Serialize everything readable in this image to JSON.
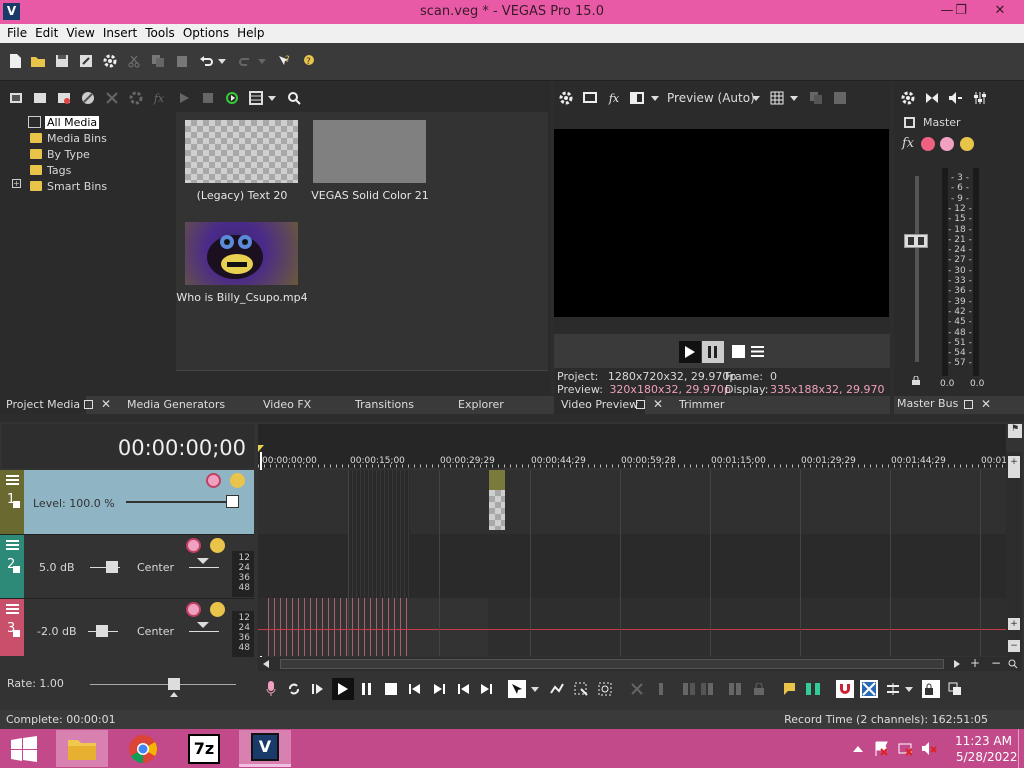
{
  "window": {
    "title": "scan.veg * - VEGAS Pro 15.0",
    "logo_letter": "V"
  },
  "menu": [
    "File",
    "Edit",
    "View",
    "Insert",
    "Tools",
    "Options",
    "Help"
  ],
  "project_media": {
    "tree": [
      "All Media",
      "Media Bins",
      "By Type",
      "Tags",
      "Smart Bins"
    ],
    "media": [
      {
        "caption": "(Legacy) Text 20"
      },
      {
        "caption": "VEGAS Solid Color 21"
      },
      {
        "caption": "Who is Billy_Csupo.mp4"
      }
    ]
  },
  "docked_tabs_left": [
    "Project Media",
    "Media Generators",
    "Video FX",
    "Transitions",
    "Explorer"
  ],
  "preview": {
    "mode_label": "Preview (Auto)",
    "project_label": "Project:",
    "project_value": "1280x720x32, 29.970p",
    "frame_label": "Frame:",
    "frame_value": "0",
    "preview_label": "Preview:",
    "preview_value": "320x180x32, 29.970p",
    "display_label": "Display:",
    "display_value": "335x188x32, 29.970",
    "tabs": [
      "Video Preview",
      "Trimmer"
    ]
  },
  "master": {
    "label": "Master",
    "scale": [
      "3",
      "6",
      "9",
      "12",
      "15",
      "18",
      "21",
      "24",
      "27",
      "30",
      "33",
      "36",
      "39",
      "42",
      "45",
      "48",
      "51",
      "54",
      "57"
    ],
    "left_value": "0.0",
    "right_value": "0.0",
    "tab": "Master Bus"
  },
  "timeline": {
    "timecode": "00:00:00;00",
    "ruler": [
      "00:00:00;00",
      "00:00:15;00",
      "00:00:29;29",
      "00:00:44;29",
      "00:00:59;28",
      "00:01:15;00",
      "00:01:29;29",
      "00:01:44;29",
      "00:01:5"
    ],
    "tracks": [
      {
        "number": "1",
        "level": "Level: 100.0 %"
      },
      {
        "number": "2",
        "volume": "5.0 dB",
        "pan": "Center",
        "gutter": [
          "12",
          "24",
          "36",
          "48"
        ]
      },
      {
        "number": "3",
        "volume": "-2.0 dB",
        "pan": "Center",
        "gutter": [
          "12",
          "24",
          "36",
          "48"
        ]
      }
    ],
    "rate": "Rate: 1.00"
  },
  "status": {
    "left": "Complete: 00:00:01",
    "right": "Record Time (2 channels): 162:51:05"
  },
  "taskbar": {
    "time": "11:23 AM",
    "date": "5/28/2022",
    "sevenzip": "7z",
    "vegas": "V"
  },
  "colors": {
    "titlebar": "#e85aa6",
    "taskbar": "#c24a8a",
    "track1": "#8fb4c4",
    "track2": "#2e8a78",
    "track3": "#c8506a",
    "accent_pink": "#f0a0b8"
  }
}
